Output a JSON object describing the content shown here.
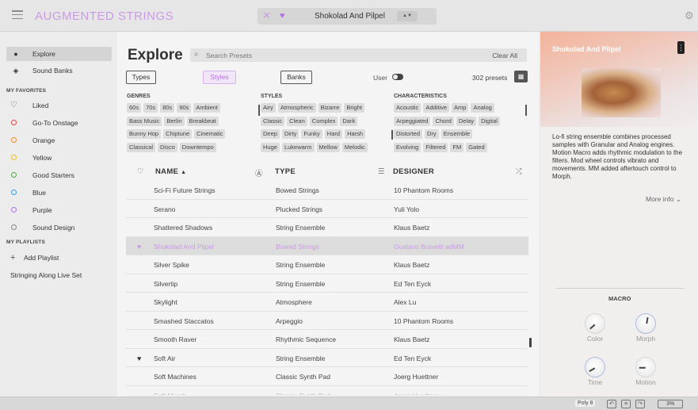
{
  "app": {
    "title": "AUGMENTED STRINGS"
  },
  "header": {
    "preset_name": "Shokolad And Pilpel",
    "close_icon": "✕",
    "heart_icon": "♥",
    "arrows": "▲▼",
    "settings_icon": "gear-icon"
  },
  "sidebar": {
    "nav": [
      {
        "label": "Explore",
        "icon": "explore-icon"
      },
      {
        "label": "Sound Banks",
        "icon": "banks-icon"
      }
    ],
    "favorites_heading": "MY FAVORITES",
    "favorites": [
      {
        "label": "Liked",
        "color": "#555555"
      },
      {
        "label": "Go-To Onstage",
        "color": "#e0463c"
      },
      {
        "label": "Orange",
        "color": "#ef8c25"
      },
      {
        "label": "Yellow",
        "color": "#edc22b"
      },
      {
        "label": "Good Starters",
        "color": "#4cae4c"
      },
      {
        "label": "Blue",
        "color": "#3c9ae0"
      },
      {
        "label": "Purple",
        "color": "#b56fe0"
      },
      {
        "label": "Sound Design",
        "color": "#888888"
      }
    ],
    "playlists_heading": "MY PLAYLISTS",
    "add_playlist": "Add Playlist",
    "playlist_name": "Stringing Along Live Set"
  },
  "main": {
    "title": "Explore",
    "search_placeholder": "Search Presets",
    "clear_all": "Clear All",
    "tabs": [
      "Types",
      "Styles",
      "Banks"
    ],
    "user_label": "User",
    "preset_count": "302 presets",
    "genres_heading": "GENRES",
    "styles_heading": "STYLES",
    "characteristics_heading": "CHARACTERISTICS",
    "genres": [
      [
        "60s",
        "70s",
        "80s",
        "90s",
        "Ambient"
      ],
      [
        "Bass Music",
        "Berlin",
        "Breakbeat"
      ],
      [
        "Bunny Hop",
        "Chiptune",
        "Cinematic"
      ],
      [
        "Classical",
        "Disco",
        "Downtempo"
      ]
    ],
    "styles": [
      [
        "Airy",
        "Atmospheric",
        "Bizarre",
        "Bright"
      ],
      [
        "Classic",
        "Clean",
        "Complex",
        "Dark"
      ],
      [
        "Deep",
        "Dirty",
        "Funky",
        "Hard",
        "Harsh"
      ],
      [
        "Huge",
        "Lukewarm",
        "Mellow",
        "Melodic"
      ]
    ],
    "characteristics": [
      [
        "Acoustic",
        "Additive",
        "Amp",
        "Analog"
      ],
      [
        "Arpeggiated",
        "Chord",
        "Delay",
        "Digital"
      ],
      [
        "Distorted",
        "Dry",
        "Ensemble"
      ],
      [
        "Evolving",
        "Filtered",
        "FM",
        "Gated"
      ]
    ],
    "columns": {
      "name": "NAME",
      "type": "TYPE",
      "designer": "DESIGNER"
    },
    "rows": [
      {
        "name": "Sci-Fi Future Strings",
        "type": "Bowed Strings",
        "designer": "10 Phantom Rooms",
        "liked": false
      },
      {
        "name": "Serano",
        "type": "Plucked Strings",
        "designer": "Yuli Yolo",
        "liked": false
      },
      {
        "name": "Shattered Shadows",
        "type": "String Ensemble",
        "designer": "Klaus Baetz",
        "liked": false
      },
      {
        "name": "Shokolad And Pilpel",
        "type": "Bowed Strings",
        "designer": "Gustavo Bravetti edMM",
        "liked": true,
        "selected": true
      },
      {
        "name": "Silver Spike",
        "type": "String Ensemble",
        "designer": "Klaus Baetz",
        "liked": false
      },
      {
        "name": "Silvertip",
        "type": "String Ensemble",
        "designer": "Ed Ten Eyck",
        "liked": false
      },
      {
        "name": "Skylight",
        "type": "Atmosphere",
        "designer": "Alex Lu",
        "liked": false
      },
      {
        "name": "Smashed Staccatos",
        "type": "Arpeggio",
        "designer": "10 Phantom Rooms",
        "liked": false
      },
      {
        "name": "Smooth Raver",
        "type": "Rhythmic Sequence",
        "designer": "Klaus Baetz",
        "liked": false
      },
      {
        "name": "Soft Air",
        "type": "String Ensemble",
        "designer": "Ed Ten Eyck",
        "liked": true
      },
      {
        "name": "Soft Machines",
        "type": "Classic Synth Pad",
        "designer": "Joerg Huettner",
        "liked": false
      },
      {
        "name": "Soft Marsh",
        "type": "Classic Synth Pad",
        "designer": "Joerg Huettner",
        "liked": false
      }
    ]
  },
  "details": {
    "title": "Shokolad And Pilpel",
    "description": "Lo-fi string ensemble combines processed samples with Granular and Analog engines. Motion Macro adds rhythmic modulation to the filters. Mod wheel controls vibrato and movements. MM added aftertouch control to Morph.",
    "more_info": "More info",
    "macro_label": "MACRO",
    "knobs": [
      "Color",
      "Morph",
      "Time",
      "Motion"
    ]
  },
  "status": {
    "poly": "Poly 8",
    "cpu": "3%"
  }
}
